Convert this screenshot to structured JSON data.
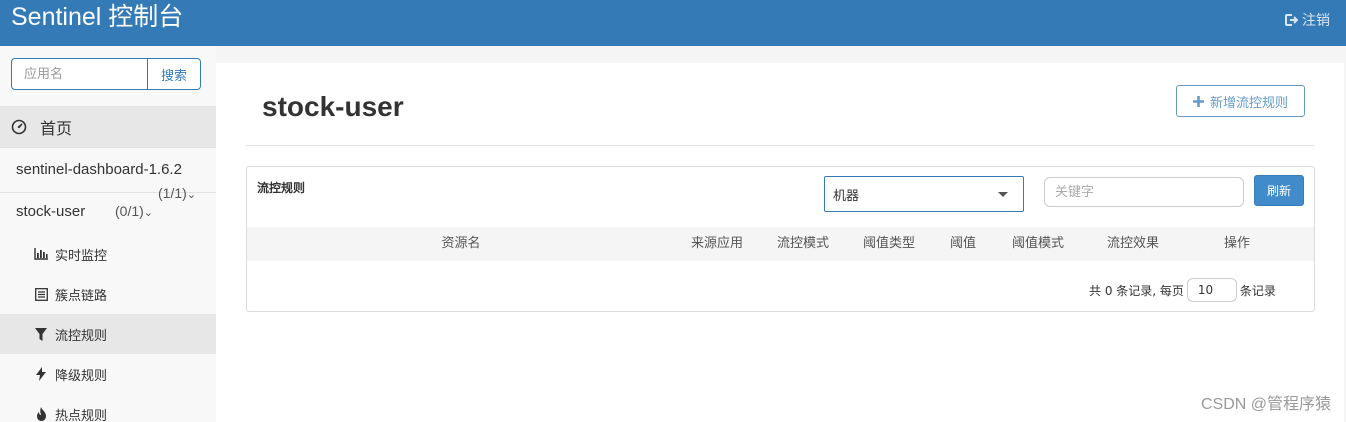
{
  "header": {
    "brand": "Sentinel 控制台",
    "logout": "注销"
  },
  "sidebar": {
    "search_placeholder": "应用名",
    "search_button": "搜索",
    "home": "首页",
    "apps": [
      {
        "name": "sentinel-dashboard-1.6.2",
        "count": "(1/1)"
      },
      {
        "name": "stock-user",
        "count": "(0/1)"
      }
    ],
    "sub_items": [
      {
        "label": "实时监控",
        "icon": "bar-chart-icon"
      },
      {
        "label": "簇点链路",
        "icon": "list-icon"
      },
      {
        "label": "流控规则",
        "icon": "filter-icon"
      },
      {
        "label": "降级规则",
        "icon": "flash-icon"
      },
      {
        "label": "热点规则",
        "icon": "fire-icon"
      }
    ]
  },
  "main": {
    "title": "stock-user",
    "add_button": "新增流控规则",
    "panel_title": "流控规则",
    "machine_select": "机器",
    "keyword_placeholder": "关键字",
    "refresh_button": "刷新",
    "columns": [
      "资源名",
      "来源应用",
      "流控模式",
      "阈值类型",
      "阈值",
      "阈值模式",
      "流控效果",
      "操作"
    ],
    "pager": {
      "total_text": "共 0 条记录, 每页",
      "page_size": "10",
      "suffix": "条记录"
    }
  },
  "watermark": "CSDN @管程序猿",
  "colors": {
    "primary": "#337ab7",
    "button": "#428bca"
  }
}
